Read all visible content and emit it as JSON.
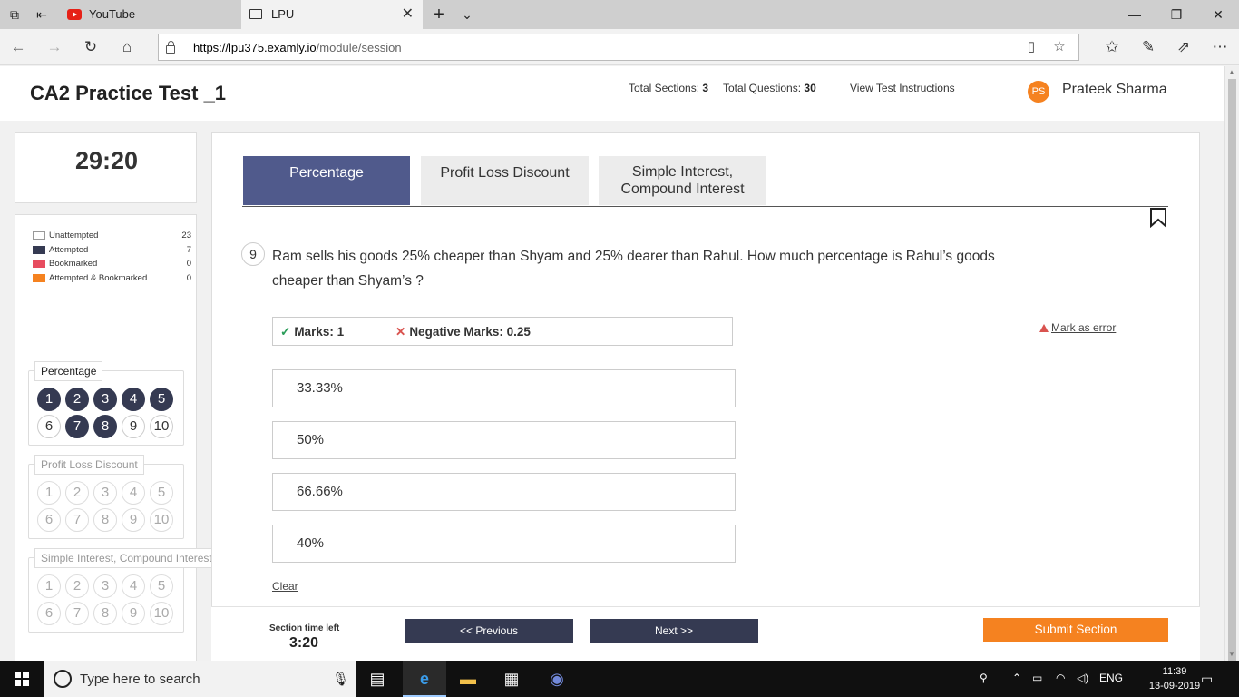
{
  "browser": {
    "tabs": [
      {
        "title": "YouTube",
        "active": false
      },
      {
        "title": "LPU",
        "active": true
      }
    ],
    "url_host": "https://lpu375.examly.io",
    "url_path": "/module/session"
  },
  "header": {
    "title": "CA2 Practice Test _1",
    "total_sections_label": "Total Sections:",
    "total_sections": "3",
    "total_questions_label": "Total Questions:",
    "total_questions": "30",
    "instructions_link": "View Test Instructions",
    "user_initials": "PS",
    "user_name": "Prateek Sharma"
  },
  "timer": "29:20",
  "legend": [
    {
      "label": "Unattempted",
      "count": "23",
      "color": "#ffffff"
    },
    {
      "label": "Attempted",
      "count": "7",
      "color": "#353a52"
    },
    {
      "label": "Bookmarked",
      "count": "0",
      "color": "#e74c5f"
    },
    {
      "label": "Attempted & Bookmarked",
      "count": "0",
      "color": "#f58220"
    }
  ],
  "palette_sections": [
    {
      "name": "Percentage",
      "active": true,
      "questions": [
        "1",
        "2",
        "3",
        "4",
        "5",
        "6",
        "7",
        "8",
        "9",
        "10"
      ],
      "attempted": [
        1,
        2,
        3,
        4,
        5,
        7,
        8
      ]
    },
    {
      "name": "Profit Loss Discount",
      "active": false,
      "questions": [
        "1",
        "2",
        "3",
        "4",
        "5",
        "6",
        "7",
        "8",
        "9",
        "10"
      ],
      "attempted": []
    },
    {
      "name": "Simple Interest, Compound Interest",
      "active": false,
      "questions": [
        "1",
        "2",
        "3",
        "4",
        "5",
        "6",
        "7",
        "8",
        "9",
        "10"
      ],
      "attempted": []
    }
  ],
  "section_tabs": [
    {
      "label": "Percentage",
      "active": true
    },
    {
      "label": "Profit Loss Discount",
      "active": false
    },
    {
      "label": "Simple Interest, Compound Interest",
      "active": false
    }
  ],
  "question": {
    "number": "9",
    "text": "Ram sells his goods 25% cheaper than Shyam and 25% dearer than Rahul. How much percentage is Rahul’s goods cheaper than Shyam’s ?",
    "marks": "Marks: 1",
    "negative_marks": "Negative Marks: 0.25",
    "mark_error": "Mark as error",
    "options": [
      "33.33%",
      "50%",
      "66.66%",
      "40%"
    ],
    "clear": "Clear"
  },
  "footer": {
    "section_time_label": "Section time left",
    "section_time": "3:20",
    "previous": "<< Previous",
    "next": "Next >>",
    "submit": "Submit Section"
  },
  "taskbar": {
    "search_placeholder": "Type here to search",
    "language": "ENG",
    "time": "11:39",
    "date": "13-09-2019"
  }
}
